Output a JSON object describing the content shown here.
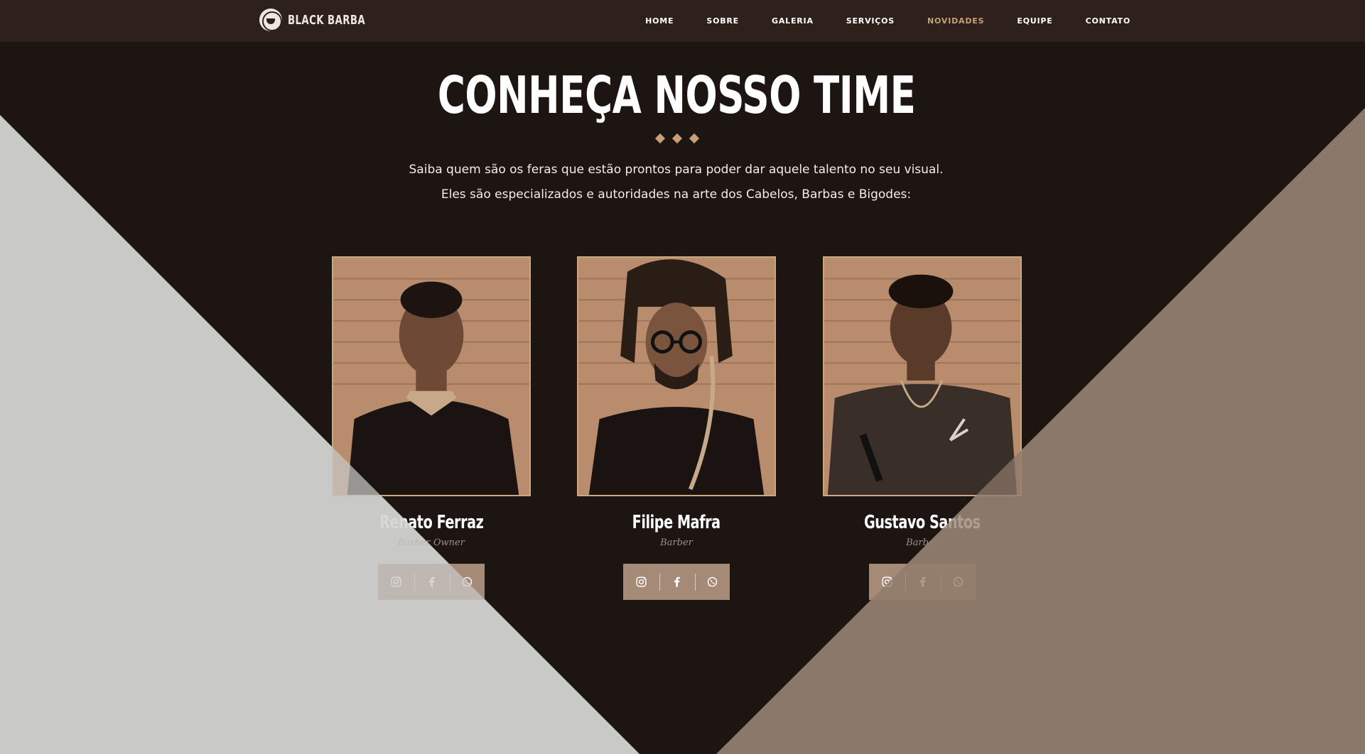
{
  "colors": {
    "header_bg": "#2e201b",
    "page_bg": "#1c1512",
    "accent": "#c79f7a",
    "left_triangle": "#c9c9c8",
    "right_triangle": "#8c7869",
    "social_bg": "#a68a78"
  },
  "header": {
    "logo_text": "BLACK BARBA",
    "nav": [
      "HOME",
      "SOBRE",
      "GALERIA",
      "SERVIÇOS",
      "NOVIDADES",
      "EQUIPE",
      "CONTATO"
    ],
    "active": "NOVIDADES"
  },
  "hero": {
    "title": "CONHEÇA NOSSO TIME",
    "subtitle_1": "Saiba quem são os feras que estão prontos para poder dar aquele talento no seu visual.",
    "subtitle_2": "Eles são especializados e autoridades na arte dos Cabelos, Barbas e Bigodes:"
  },
  "team": [
    {
      "name": "Renato Ferraz",
      "role": "Barber Owner",
      "social": [
        "instagram-icon",
        "facebook-icon",
        "whatsapp-icon"
      ]
    },
    {
      "name": "Filipe Mafra",
      "role": "Barber",
      "social": [
        "instagram-icon",
        "facebook-icon",
        "whatsapp-icon"
      ]
    },
    {
      "name": "Gustavo Santos",
      "role": "Barber",
      "social": [
        "instagram-icon",
        "facebook-icon",
        "whatsapp-icon"
      ]
    }
  ]
}
